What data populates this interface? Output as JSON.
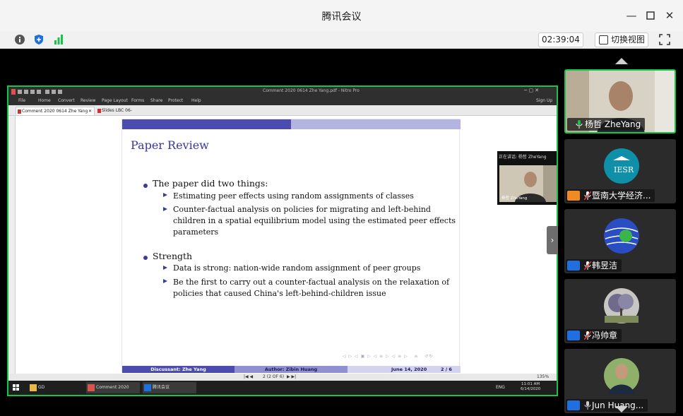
{
  "window": {
    "title": "腾讯会议"
  },
  "toolbar": {
    "timer": "02:39:04",
    "switch_view": "切换视图"
  },
  "shared_app": {
    "title": "Comment 2020 0614 Zhe Yang.pdf - Nitro Pro",
    "ribbon": [
      "File",
      "Home",
      "Convert",
      "Review",
      "Page Layout",
      "Forms",
      "Share",
      "Protect",
      "Help"
    ],
    "sign_up": "Sign Up",
    "tabs": [
      "Comment 2020 0614 Zhe Yang",
      "Slides LBC 06-12.pdf"
    ],
    "page_indicator": "2 (2 OF 6)",
    "zoom": "135%",
    "taskbar": [
      "GD",
      "Comment 2020 061...",
      "腾讯会议"
    ],
    "clock_time": "11:01 AM",
    "clock_date": "6/14/2020",
    "lang": "ENG",
    "presenter_label": "正在讲话: 杨哲 ZheYang",
    "presenter_name": "杨哲 ZheYang"
  },
  "slide": {
    "title": "Paper Review",
    "bullets": [
      {
        "text": "The paper did two things:",
        "sub": [
          [
            "Estimating peer effects using random assignments of classes"
          ],
          [
            "Counter-factual analysis on policies for migrating and left-behind",
            "children in a spatial equilibrium model using the estimated peer effects",
            "parameters"
          ]
        ]
      },
      {
        "text": "Strength",
        "sub": [
          [
            "Data is strong: nation-wide random assignment of peer groups"
          ],
          [
            "Be the first to carry out a counter-factual analysis on the relaxation of",
            "policies that caused China's left-behind-children issue"
          ]
        ]
      }
    ],
    "footer": {
      "discussant": "Discussant: Zhe Yang",
      "author": "Author: Zibin Huang",
      "date": "June 14, 2020",
      "page": "2 / 6"
    }
  },
  "participants": [
    {
      "name": "杨哲 ZheYang",
      "mic": "on",
      "type": "video"
    },
    {
      "name": "暨南大学经济...",
      "mic": "muted",
      "type": "logo",
      "logo_text": "IESR"
    },
    {
      "name": "韩昱洁",
      "mic": "muted",
      "type": "globe"
    },
    {
      "name": "冯帅章",
      "mic": "muted",
      "type": "tree"
    },
    {
      "name": "Jun Huang...",
      "mic": "off",
      "type": "photo"
    }
  ],
  "colors": {
    "active_green": "#19c24b",
    "beamer_dark": "#4b4bb0",
    "beamer_light": "#b4b4e2",
    "muted_red": "#e53935",
    "avatar_blue": "#1f6fe0",
    "avatar_orange": "#f08a24"
  }
}
